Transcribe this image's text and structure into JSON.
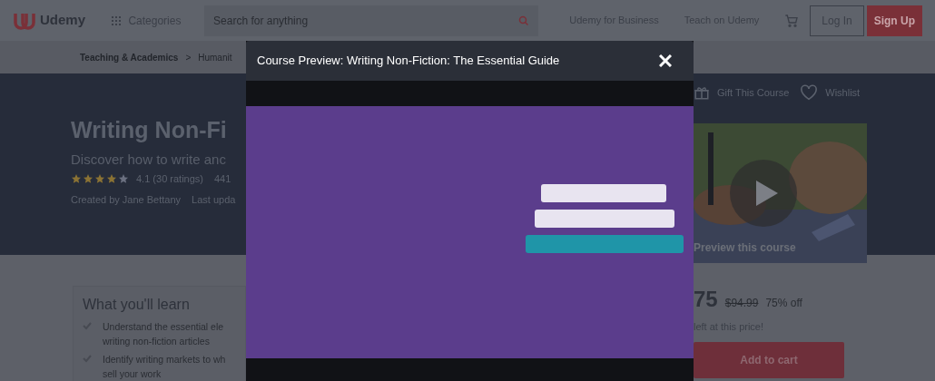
{
  "header": {
    "logo": "Udemy",
    "categories": "Categories",
    "search": {
      "placeholder": "Search for anything"
    },
    "links": [
      "Udemy for Business",
      "Teach on Udemy"
    ],
    "login": "Log In",
    "signup": "Sign Up"
  },
  "breadcrumb": {
    "items": [
      "Teaching & Academics",
      "Humanit"
    ],
    "separator": ">"
  },
  "course": {
    "title": "Writing Non-Fi",
    "subtitle": "Discover how to write anc",
    "stars": 4,
    "rating": "4.1 (30 ratings)",
    "students": "441",
    "created_by": "Created by Jane Bettany",
    "updated": "Last upda"
  },
  "actions": [
    "Gift This Course",
    "Wishlist"
  ],
  "preview": {
    "label": "Preview this course"
  },
  "price": {
    "current": "75",
    "original": "$94.99",
    "discount": "75% off",
    "note": "left at this price!",
    "button": "Add to cart"
  },
  "learn": {
    "title": "What you'll learn",
    "items": [
      {
        "lines": [
          "Understand the essential ele",
          "writing non-fiction articles"
        ]
      },
      {
        "lines": [
          "Identify writing markets to wh",
          "sell your work"
        ]
      }
    ]
  },
  "modal": {
    "title": "Course Preview: Writing Non-Fiction: The Essential Guide"
  }
}
